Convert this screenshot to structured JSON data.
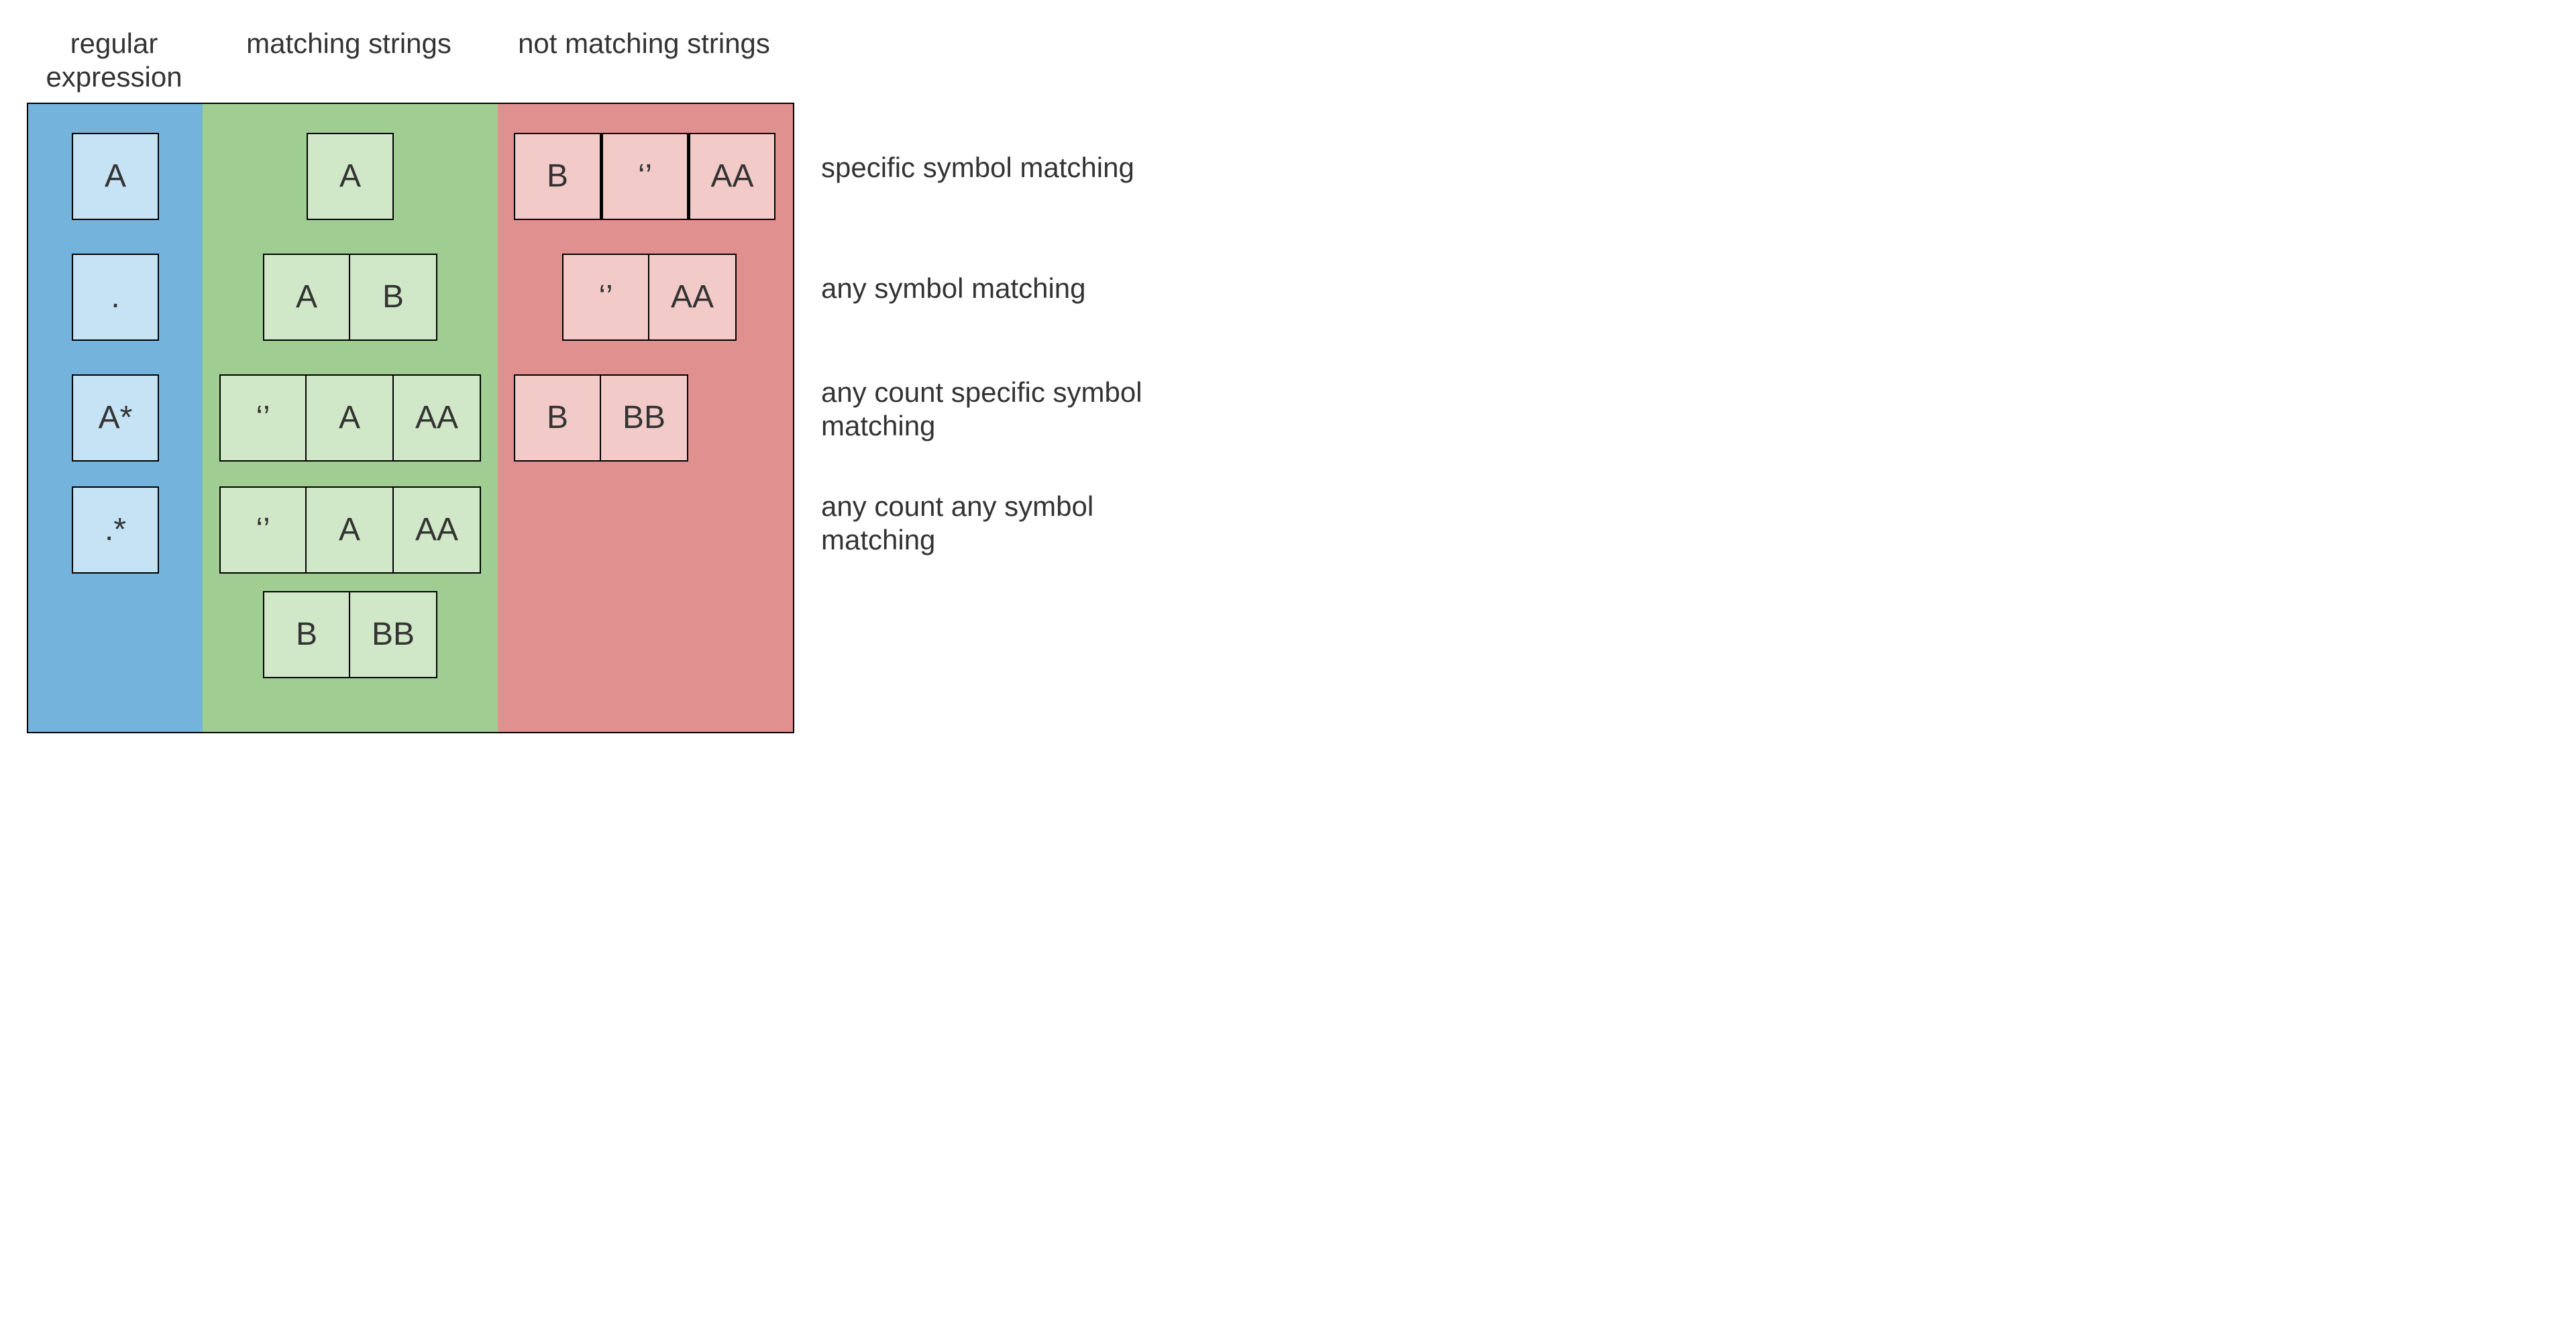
{
  "headers": {
    "regex": "regular expression",
    "match": "matching strings",
    "nomatch": "not matching strings"
  },
  "rows": [
    {
      "regex": "A",
      "match": [
        "A"
      ],
      "nomatch": [
        "B",
        "‘’",
        "AA"
      ],
      "description": "specific symbol matching"
    },
    {
      "regex": ".",
      "match": [
        "A",
        "B"
      ],
      "nomatch": [
        "‘’",
        "AA"
      ],
      "description": "any symbol matching"
    },
    {
      "regex": "A*",
      "match": [
        "‘’",
        "A",
        "AA"
      ],
      "nomatch": [
        "B",
        "BB"
      ],
      "description": "any count specific symbol matching"
    },
    {
      "regex": ".*",
      "match_rows": [
        [
          "‘’",
          "A",
          "AA"
        ],
        [
          "B",
          "BB"
        ]
      ],
      "nomatch": [],
      "description": "any count any symbol matching"
    }
  ],
  "colors": {
    "blue_bg": "#74b3dc",
    "green_bg": "#a0ce92",
    "pink_bg": "#e0918f",
    "blue_cell": "#c6e2f5",
    "green_cell": "#d1e8c8",
    "pink_cell": "#f2cbc9"
  }
}
